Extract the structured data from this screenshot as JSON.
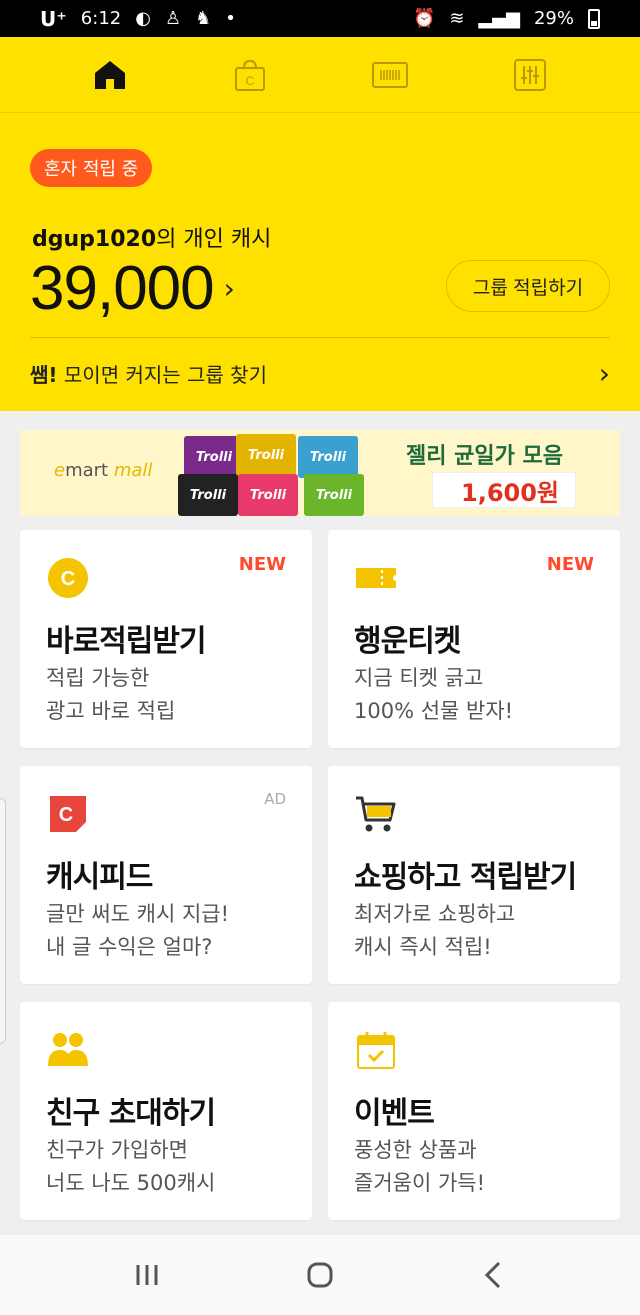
{
  "status_bar": {
    "carrier": "U⁺",
    "time": "6:12",
    "battery": "29%"
  },
  "tabs": [
    {
      "name": "home",
      "active": true
    },
    {
      "name": "shopping",
      "letter": "C"
    },
    {
      "name": "barcode"
    },
    {
      "name": "settings"
    }
  ],
  "header": {
    "badge": "혼자 적립 중",
    "user_id": "dgup1020",
    "cash_label": "의 개인 캐시",
    "cash_amount": "39,000",
    "group_button": "그룹 적립하기",
    "find_bold": "쌤!",
    "find_text": "모이면 커지는 그룹 찾기"
  },
  "banner": {
    "brand_prefix": "e",
    "brand_rest": "mart ",
    "brand_mall": "mall",
    "product_brand": "Trolli",
    "title": "젤리 균일가 모음",
    "price": "1,600원"
  },
  "cards": [
    {
      "title": "바로적립받기",
      "desc1": "적립 가능한",
      "desc2": "광고 바로 적립",
      "tag": "NEW",
      "icon_letter": "C"
    },
    {
      "title": "행운티켓",
      "desc1": "지금 티켓 긁고",
      "desc2": "100% 선물 받자!",
      "tag": "NEW"
    },
    {
      "title": "캐시피드",
      "desc1": "글만 써도 캐시 지급!",
      "desc2": "내 글 수익은 얼마?",
      "tag": "AD",
      "icon_letter": "C"
    },
    {
      "title": "쇼핑하고 적립받기",
      "desc1": "최저가로 쇼핑하고",
      "desc2": "캐시 즉시 적립!"
    },
    {
      "title": "친구 초대하기",
      "desc1": "친구가 가입하면",
      "desc2": "너도 나도 500캐시"
    },
    {
      "title": "이벤트",
      "desc1": "풍성한 상품과",
      "desc2": "즐거움이 가득!"
    }
  ],
  "colors": {
    "header_yellow": "#ffe100",
    "badge_orange": "#ff5a1e",
    "new_red": "#ff4a2d",
    "icon_yellow": "#f5c400",
    "feed_red": "#e8453c"
  }
}
